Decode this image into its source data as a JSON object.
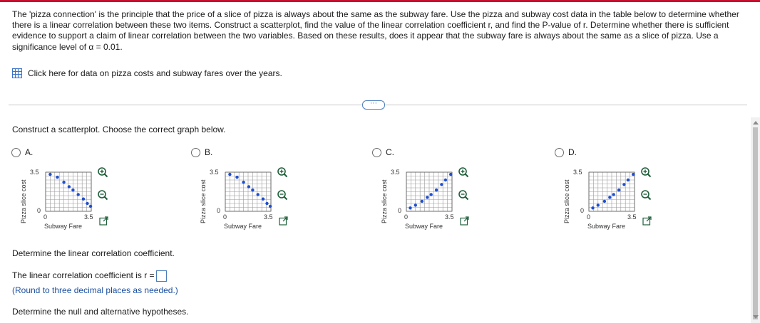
{
  "question": {
    "text": "The 'pizza connection' is the principle that the price of a slice of pizza is always about the same as the subway fare. Use the pizza and subway cost data in the table below to determine whether there is a linear correlation between these two items. Construct a scatterplot, find the value of the linear correlation coefficient r, and find the P-value of r. Determine whether there is sufficient evidence to support a claim of linear correlation between the two variables. Based on these results, does it appear that the subway fare is always about the same as a slice of pizza. Use a significance level of α = 0.01."
  },
  "data_link": {
    "label": "Click here for data on pizza costs and subway fares over the years."
  },
  "more_button": {
    "label": "⋯"
  },
  "construct_prompt": "Construct a scatterplot. Choose the correct graph below.",
  "options": [
    {
      "label": "A.",
      "ylabel": "Pizza slice cost",
      "xlabel": "Subway Fare",
      "ytick_top": "3.5",
      "ytick_bottom": "0",
      "xtick_left": "0",
      "xtick_right": "3.5",
      "trend": "decreasing"
    },
    {
      "label": "B.",
      "ylabel": "Pizza slice cost",
      "xlabel": "Subway Fare",
      "ytick_top": "3.5",
      "ytick_bottom": "0",
      "xtick_left": "0",
      "xtick_right": "3.5",
      "trend": "decreasing"
    },
    {
      "label": "C.",
      "ylabel": "Pizza slice cost",
      "xlabel": "Subway Fare",
      "ytick_top": "3.5",
      "ytick_bottom": "0",
      "xtick_left": "0",
      "xtick_right": "3.5",
      "trend": "increasing"
    },
    {
      "label": "D.",
      "ylabel": "Pizza slice cost",
      "xlabel": "Subway Fare",
      "ytick_top": "3.5",
      "ytick_bottom": "0",
      "xtick_left": "0",
      "xtick_right": "3.5",
      "trend": "increasing"
    }
  ],
  "correlation": {
    "heading": "Determine the linear correlation coefficient.",
    "prompt": "The linear correlation coefficient is r =",
    "hint": "(Round to three decimal places as needed.)"
  },
  "hypotheses": {
    "heading": "Determine the null and alternative hypotheses."
  },
  "colors": {
    "accent": "#c8102e",
    "link_blue": "#1a4fa0",
    "point_blue": "#1f4fd1",
    "grid": "#9a9a9a"
  }
}
